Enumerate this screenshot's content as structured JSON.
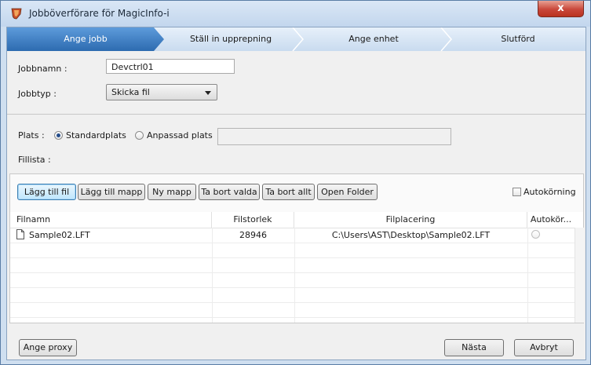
{
  "window": {
    "title": "Jobböverförare för MagicInfo-i",
    "close_label": "x"
  },
  "steps": {
    "items": [
      {
        "label": "Ange jobb",
        "active": true
      },
      {
        "label": "Ställ in upprepning",
        "active": false
      },
      {
        "label": "Ange enhet",
        "active": false
      },
      {
        "label": "Slutförd",
        "active": false
      }
    ]
  },
  "form": {
    "job_name_label": "Jobbnamn :",
    "job_name_value": "Devctrl01",
    "job_type_label": "Jobbtyp :",
    "job_type_value": "Skicka fil"
  },
  "location": {
    "label": "Plats :",
    "standard_label": "Standardplats",
    "standard_selected": true,
    "custom_label": "Anpassad plats",
    "custom_path": ""
  },
  "filelist": {
    "label": "Fillista :",
    "buttons": {
      "add_file": "Lägg till fil",
      "add_folder": "Lägg till mapp",
      "new_folder": "Ny mapp",
      "remove_selected": "Ta bort valda",
      "remove_all": "Ta bort allt",
      "open_folder": "Open Folder"
    },
    "autorun_label": "Autokörning",
    "autorun_checked": false,
    "columns": [
      "Filnamn",
      "Filstorlek",
      "Filplacering",
      "Autokör..."
    ],
    "rows": [
      {
        "name": "Sample02.LFT",
        "size": "28946",
        "location": "C:\\Users\\AST\\Desktop\\Sample02.LFT",
        "autorun": false
      }
    ]
  },
  "footer": {
    "proxy_label": "Ange proxy",
    "next_label": "Nästa",
    "cancel_label": "Avbryt"
  },
  "colors": {
    "step_active": "#3c7fc4",
    "step_inactive": "#d4e3f3",
    "window_border": "#5a7da6",
    "close_red": "#c9473a"
  }
}
